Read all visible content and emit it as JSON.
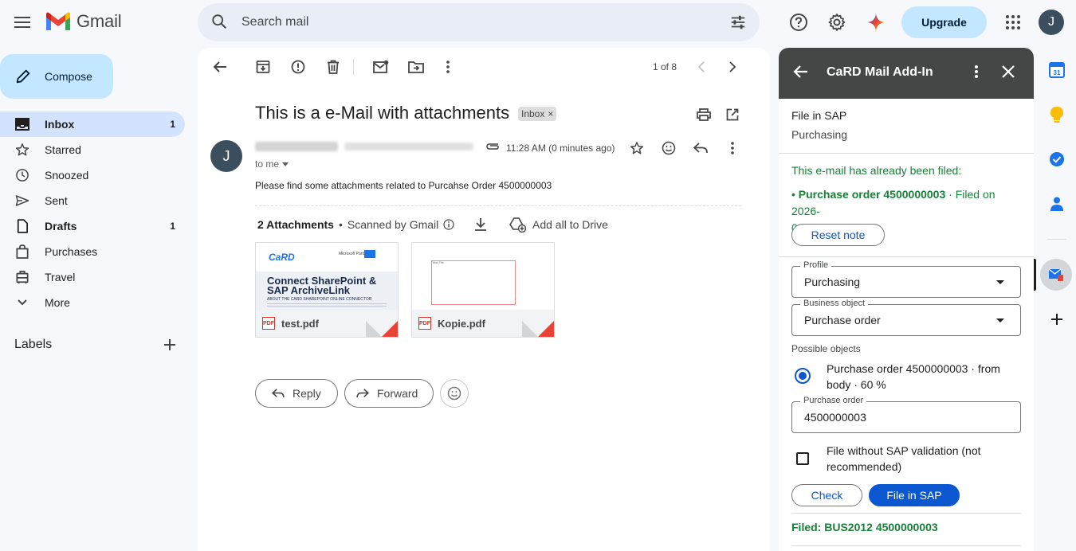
{
  "app": {
    "name": "Gmail"
  },
  "search": {
    "placeholder": "Search mail"
  },
  "header": {
    "upgrade_label": "Upgrade",
    "avatar_letter": "J"
  },
  "compose": {
    "label": "Compose"
  },
  "sidebar": {
    "items": [
      {
        "label": "Inbox",
        "count": "1",
        "icon": "inbox-icon",
        "active": true,
        "bold": true
      },
      {
        "label": "Starred",
        "count": "",
        "icon": "star-icon"
      },
      {
        "label": "Snoozed",
        "count": "",
        "icon": "clock-icon"
      },
      {
        "label": "Sent",
        "count": "",
        "icon": "send-icon"
      },
      {
        "label": "Drafts",
        "count": "1",
        "icon": "draft-icon",
        "bold": true
      },
      {
        "label": "Purchases",
        "count": "",
        "icon": "shopping-bag-icon"
      },
      {
        "label": "Travel",
        "count": "",
        "icon": "luggage-icon"
      },
      {
        "label": "More",
        "count": "",
        "icon": "chevron-down-icon"
      }
    ],
    "labels_heading": "Labels"
  },
  "toolbar": {
    "pager": "1 of 8"
  },
  "message": {
    "subject": "This is a e-Mail with attachments",
    "label_chip": "Inbox",
    "sender_letter": "J",
    "time": "11:28 AM (0 minutes ago)",
    "to": "to me",
    "body": "Please find some attachments related to Purcahse Order 4500000003"
  },
  "attachments": {
    "count_label": "2 Attachments",
    "scanned": "Scanned by Gmail",
    "add_all": "Add all to Drive",
    "files": [
      {
        "name": "test.pdf",
        "preview_logo": "CaRD",
        "preview_partner": "Microsoft Partner",
        "preview_title": "Connect SharePoint & SAP ArchiveLink",
        "preview_subtitle": "ABOUT THE CARD SHAREPOINT ONLINE CONNECTOR"
      },
      {
        "name": "Kopie.pdf",
        "preview_text": "Test File"
      }
    ]
  },
  "actions": {
    "reply": "Reply",
    "forward": "Forward"
  },
  "addon": {
    "title": "CaRD Mail Add-In",
    "section_title": "File in SAP",
    "section_sub": "Purchasing",
    "filed_notice": "This e-mail has already been filed:",
    "filed_item": "Purchase order 4500000003",
    "filed_date_line1": " · Filed on 2026-",
    "filed_date_line2": "08-24",
    "reset_label": "Reset note",
    "profile_label": "Profile",
    "profile_value": "Purchasing",
    "business_label": "Business object",
    "business_value": "Purchase order",
    "possible_label": "Possible objects",
    "possible_line1": "Purchase order 4500000003 · from",
    "possible_line2": "body · 60 %",
    "po_label": "Purchase order",
    "po_value": "4500000003",
    "checkbox_line1": "File without SAP validation (not",
    "checkbox_line2": "recommended)",
    "check_label": "Check",
    "file_label": "File in SAP",
    "filed_result": "Filed: BUS2012 4500000003"
  },
  "colors": {
    "accent": "#0b57d0",
    "compose_bg": "#c2e7ff",
    "addon_header": "#444746",
    "success": "#188038"
  }
}
